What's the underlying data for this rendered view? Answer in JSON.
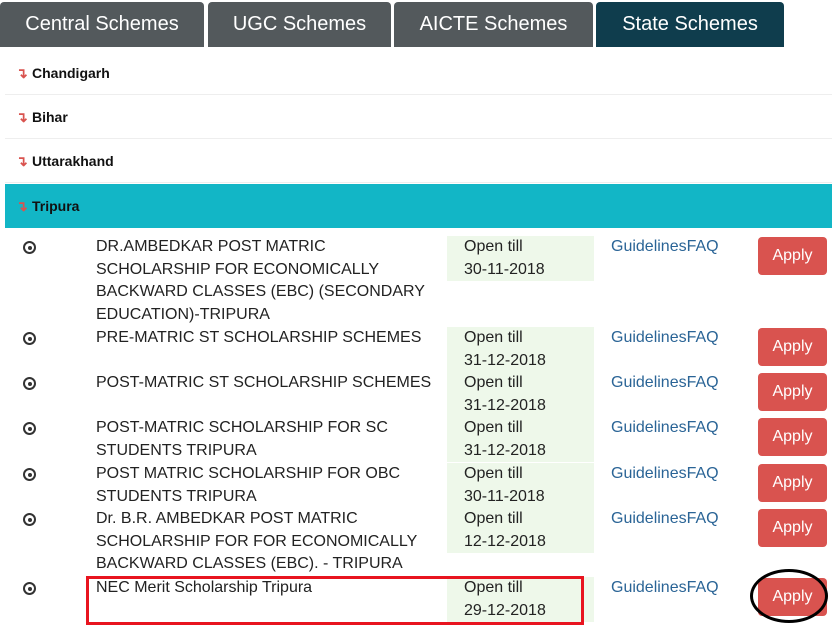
{
  "tabs": [
    {
      "label": "Central Schemes",
      "active": false
    },
    {
      "label": "UGC Schemes",
      "active": false
    },
    {
      "label": "AICTE Schemes",
      "active": false
    },
    {
      "label": "State Schemes",
      "active": true
    }
  ],
  "states": [
    {
      "name": "Chandigarh",
      "expanded": false
    },
    {
      "name": "Bihar",
      "expanded": false
    },
    {
      "name": "Uttarakhand",
      "expanded": false
    },
    {
      "name": "Tripura",
      "expanded": true
    }
  ],
  "arrow_glyph": "↴",
  "schemes": [
    {
      "name": "DR.AMBEDKAR POST MATRIC SCHOLARSHIP FOR ECONOMICALLY BACKWARD CLASSES (EBC) (SECONDARY EDUCATION)-TRIPURA",
      "open_label": "Open till",
      "open_date": "30-11-2018",
      "guidelines": "Guidelines",
      "faq": "FAQ",
      "apply": "Apply"
    },
    {
      "name": "PRE-MATRIC ST SCHOLARSHIP SCHEMES",
      "open_label": "Open till",
      "open_date": "31-12-2018",
      "guidelines": "Guidelines",
      "faq": "FAQ",
      "apply": "Apply"
    },
    {
      "name": "POST-MATRIC ST SCHOLARSHIP SCHEMES",
      "open_label": "Open till",
      "open_date": "31-12-2018",
      "guidelines": "Guidelines",
      "faq": "FAQ",
      "apply": "Apply"
    },
    {
      "name": "POST-MATRIC SCHOLARSHIP FOR SC STUDENTS TRIPURA",
      "open_label": "Open till",
      "open_date": "31-12-2018",
      "guidelines": "Guidelines",
      "faq": "FAQ",
      "apply": "Apply"
    },
    {
      "name": "POST MATRIC SCHOLARSHIP FOR OBC STUDENTS TRIPURA",
      "open_label": "Open till",
      "open_date": "30-11-2018",
      "guidelines": "Guidelines",
      "faq": "FAQ",
      "apply": "Apply"
    },
    {
      "name": "Dr. B.R. AMBEDKAR POST MATRIC SCHOLARSHIP FOR FOR ECONOMICALLY BACKWARD CLASSES (EBC). - TRIPURA",
      "open_label": "Open till",
      "open_date": "12-12-2018",
      "guidelines": "Guidelines",
      "faq": "FAQ",
      "apply": "Apply"
    },
    {
      "name": "NEC Merit Scholarship Tripura",
      "open_label": "Open till",
      "open_date": "29-12-2018",
      "guidelines": "Guidelines",
      "faq": "FAQ",
      "apply": "Apply"
    }
  ]
}
